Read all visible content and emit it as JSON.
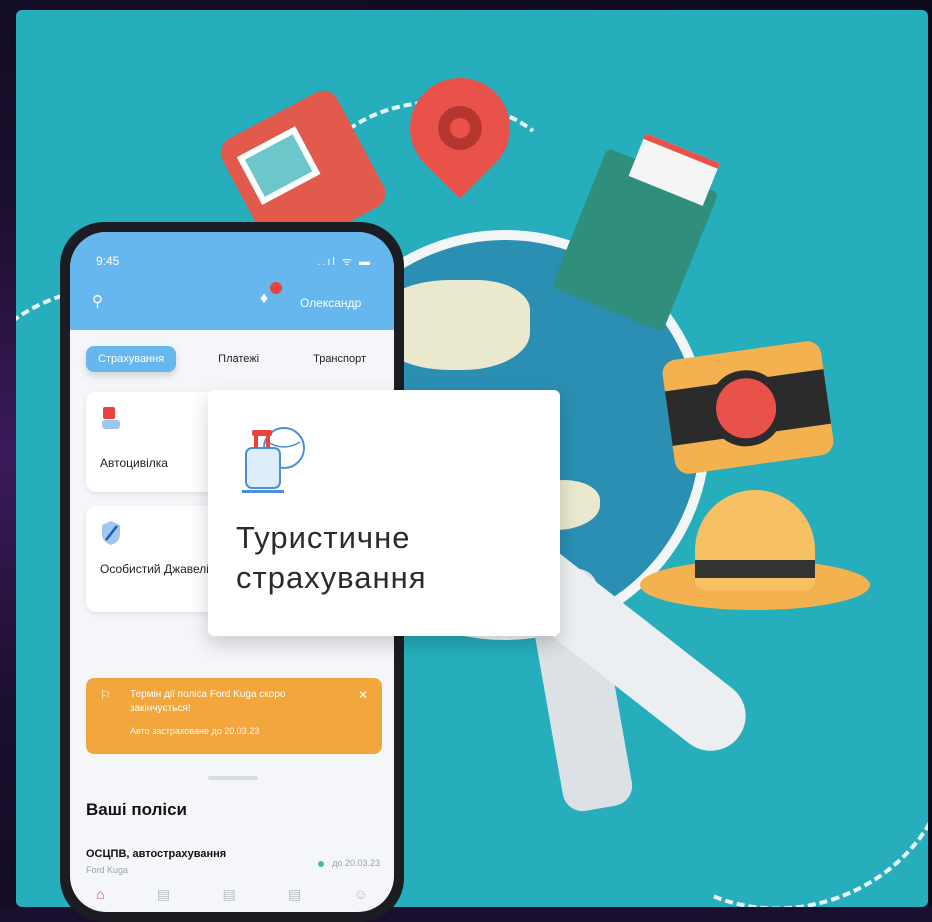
{
  "phone": {
    "status_time": "9:45",
    "status_icons": "..ıl ᯤ ▬",
    "user_name": "Олександр",
    "tabs": [
      "Страхування",
      "Платежі",
      "Транспорт"
    ],
    "active_tab": 0,
    "cards": [
      {
        "label": "Автоцивілка"
      },
      {
        "label": "Особистий Джавелін"
      }
    ],
    "notice": {
      "text": "Термін дії поліса Ford Kuga скоро закінчується!",
      "subtext": "Авто застраховане до 20.03.23"
    },
    "section_title": "Ваші поліси",
    "policy": {
      "name": "ОСЦПВ, автострахування",
      "sub": "Ford Kuga",
      "date": "до 20.03.23"
    }
  },
  "popup": {
    "title_line1": "Туристичне",
    "title_line2": "страхування"
  },
  "colors": {
    "background": "#26aebd",
    "appbar": "#67b7ef",
    "notice": "#f2a63b",
    "accent_red": "#e8433e"
  }
}
